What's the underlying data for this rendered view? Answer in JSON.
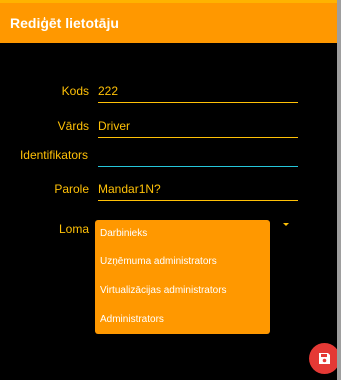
{
  "header": {
    "title": "Rediģēt lietotāju"
  },
  "form": {
    "kods": {
      "label": "Kods",
      "value": "222"
    },
    "vards": {
      "label": "Vārds",
      "value": "Driver"
    },
    "identifikators": {
      "label": "Identifikators",
      "value": ""
    },
    "parole": {
      "label": "Parole",
      "value": "Mandar1N?"
    },
    "loma": {
      "label": "Loma"
    }
  },
  "dropdown": {
    "options": [
      "Darbinieks",
      "Uzņēmuma administrators",
      "Virtualizācijas administrators",
      "Administrators"
    ]
  },
  "colors": {
    "accent": "#ff9800",
    "text_accent": "#ffc107",
    "focus": "#26c6da",
    "fab": "#e53935"
  },
  "icons": {
    "fab": "save-icon",
    "select": "dropdown-arrow-icon"
  }
}
